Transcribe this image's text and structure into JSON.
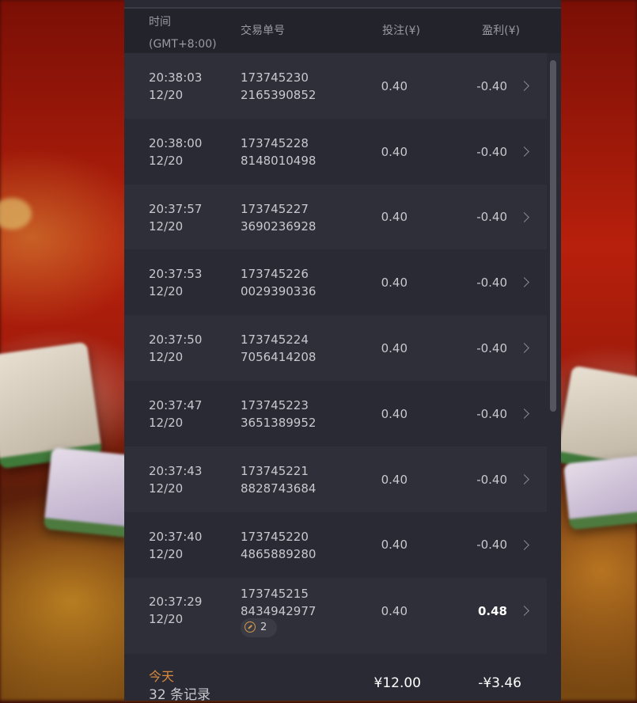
{
  "header": {
    "time_label": "时间",
    "timezone": "(GMT+8:00)",
    "order_label": "交易单号",
    "bet_label": "投注(¥)",
    "profit_label": "盈利(¥)"
  },
  "rows": [
    {
      "time": "20:38:03",
      "date": "12/20",
      "id_line1": "173745230",
      "id_line2": "2165390852",
      "bet": "0.40",
      "profit": "-0.40"
    },
    {
      "time": "20:38:00",
      "date": "12/20",
      "id_line1": "173745228",
      "id_line2": "8148010498",
      "bet": "0.40",
      "profit": "-0.40"
    },
    {
      "time": "20:37:57",
      "date": "12/20",
      "id_line1": "173745227",
      "id_line2": "3690236928",
      "bet": "0.40",
      "profit": "-0.40"
    },
    {
      "time": "20:37:53",
      "date": "12/20",
      "id_line1": "173745226",
      "id_line2": "0029390336",
      "bet": "0.40",
      "profit": "-0.40"
    },
    {
      "time": "20:37:50",
      "date": "12/20",
      "id_line1": "173745224",
      "id_line2": "7056414208",
      "bet": "0.40",
      "profit": "-0.40"
    },
    {
      "time": "20:37:47",
      "date": "12/20",
      "id_line1": "173745223",
      "id_line2": "3651389952",
      "bet": "0.40",
      "profit": "-0.40"
    },
    {
      "time": "20:37:43",
      "date": "12/20",
      "id_line1": "173745221",
      "id_line2": "8828743684",
      "bet": "0.40",
      "profit": "-0.40"
    },
    {
      "time": "20:37:40",
      "date": "12/20",
      "id_line1": "173745220",
      "id_line2": "4865889280",
      "bet": "0.40",
      "profit": "-0.40"
    },
    {
      "time": "20:37:29",
      "date": "12/20",
      "id_line1": "173745215",
      "id_line2": "8434942977",
      "bet": "0.40",
      "profit": "0.48",
      "badge_count": "2"
    }
  ],
  "footer": {
    "today_label": "今天",
    "records_label": "32 条记录",
    "total_bet": "¥12.00",
    "total_profit": "-¥3.46"
  },
  "colors": {
    "panel_bg": "#2a2a35",
    "row_alt_bg": "#2f2f3a",
    "header_bg": "#23232c",
    "accent_orange": "#d88a3c",
    "background_red": "#b7200c"
  },
  "icons": {
    "row_chevron": "chevron-right-icon",
    "badge_icon": "compass-icon"
  }
}
